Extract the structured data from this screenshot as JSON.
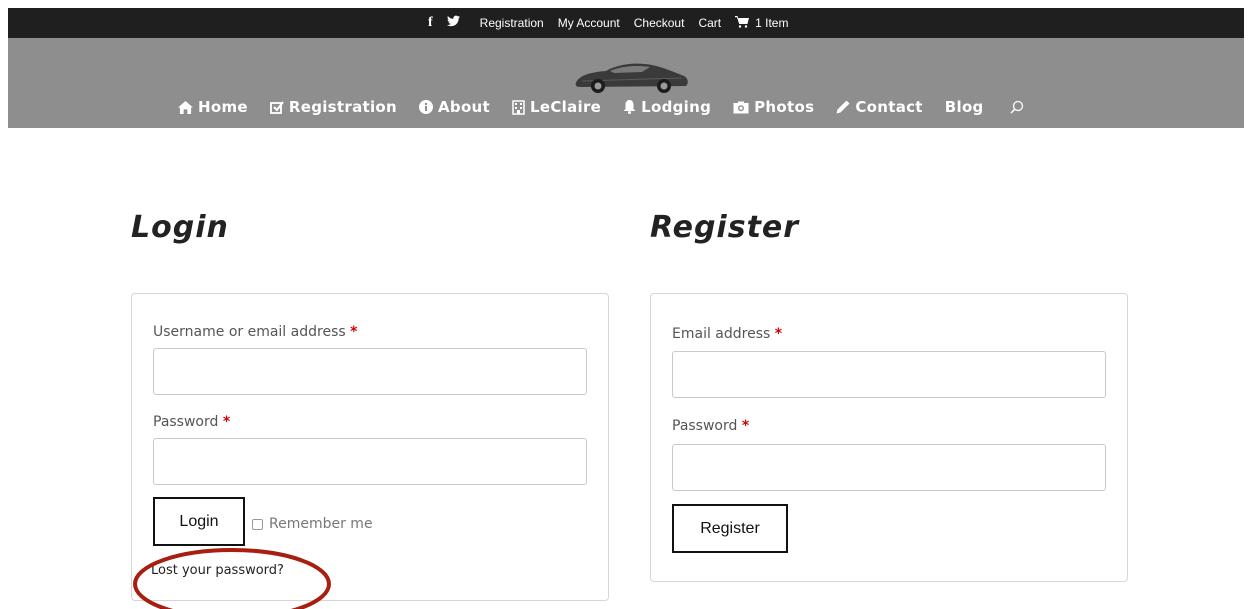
{
  "topbar": {
    "social": [
      "f",
      "twitter"
    ],
    "links": [
      "Registration",
      "My Account",
      "Checkout",
      "Cart"
    ],
    "cart_count": "1 Item"
  },
  "nav": {
    "items": [
      {
        "label": "Home",
        "icon": "home-icon"
      },
      {
        "label": "Registration",
        "icon": "check-square-icon"
      },
      {
        "label": "About",
        "icon": "info-icon"
      },
      {
        "label": "LeClaire",
        "icon": "building-icon"
      },
      {
        "label": "Lodging",
        "icon": "bell-icon"
      },
      {
        "label": "Photos",
        "icon": "camera-icon"
      },
      {
        "label": "Contact",
        "icon": "pencil-icon"
      },
      {
        "label": "Blog",
        "icon": ""
      }
    ]
  },
  "login": {
    "heading": "Login",
    "username_label": "Username or email address",
    "password_label": "Password",
    "button": "Login",
    "remember": "Remember me",
    "lost": "Lost your password?"
  },
  "register": {
    "heading": "Register",
    "email_label": "Email address",
    "password_label": "Password",
    "button": "Register"
  },
  "colors": {
    "topbar": "#1f1f1f",
    "header": "#8e8e8e",
    "required": "#d00000",
    "annotation": "#a81f12"
  }
}
